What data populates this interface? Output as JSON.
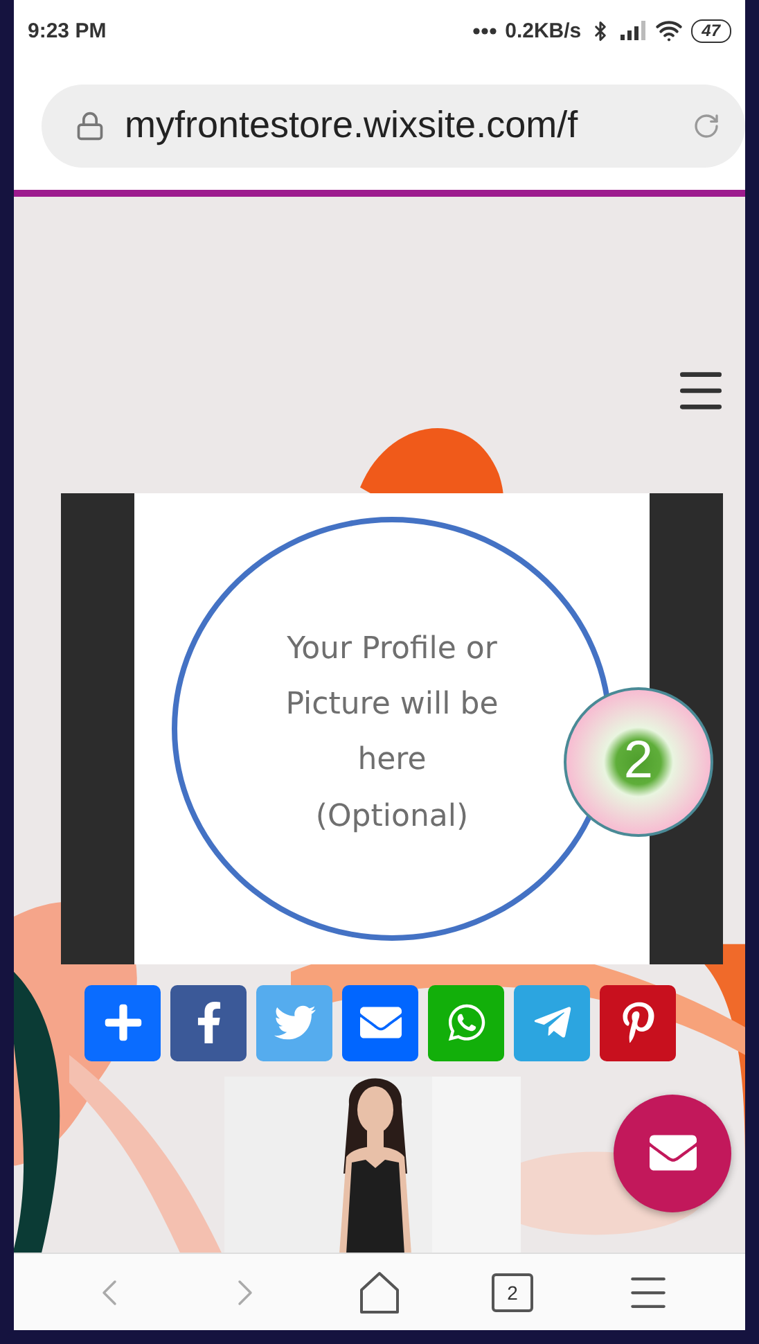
{
  "status_bar": {
    "time": "9:23 PM",
    "speed": "0.2KB/s",
    "battery": "47"
  },
  "address_bar": {
    "url": "myfrontestore.wixsite.com/f"
  },
  "profile_card": {
    "caption": "Your Profile or Picture will be here",
    "note": "(Optional)"
  },
  "step_badge": "2",
  "share_buttons": [
    {
      "kind": "add",
      "color": "#0a6cff"
    },
    {
      "kind": "facebook",
      "color": "#3b5998"
    },
    {
      "kind": "twitter",
      "color": "#55acee"
    },
    {
      "kind": "email",
      "color": "#0166ff"
    },
    {
      "kind": "whatsapp",
      "color": "#12af0a"
    },
    {
      "kind": "telegram",
      "color": "#2ca5e0"
    },
    {
      "kind": "pinterest",
      "color": "#c8101e"
    }
  ],
  "bottom_nav": {
    "tab_count": "2"
  }
}
